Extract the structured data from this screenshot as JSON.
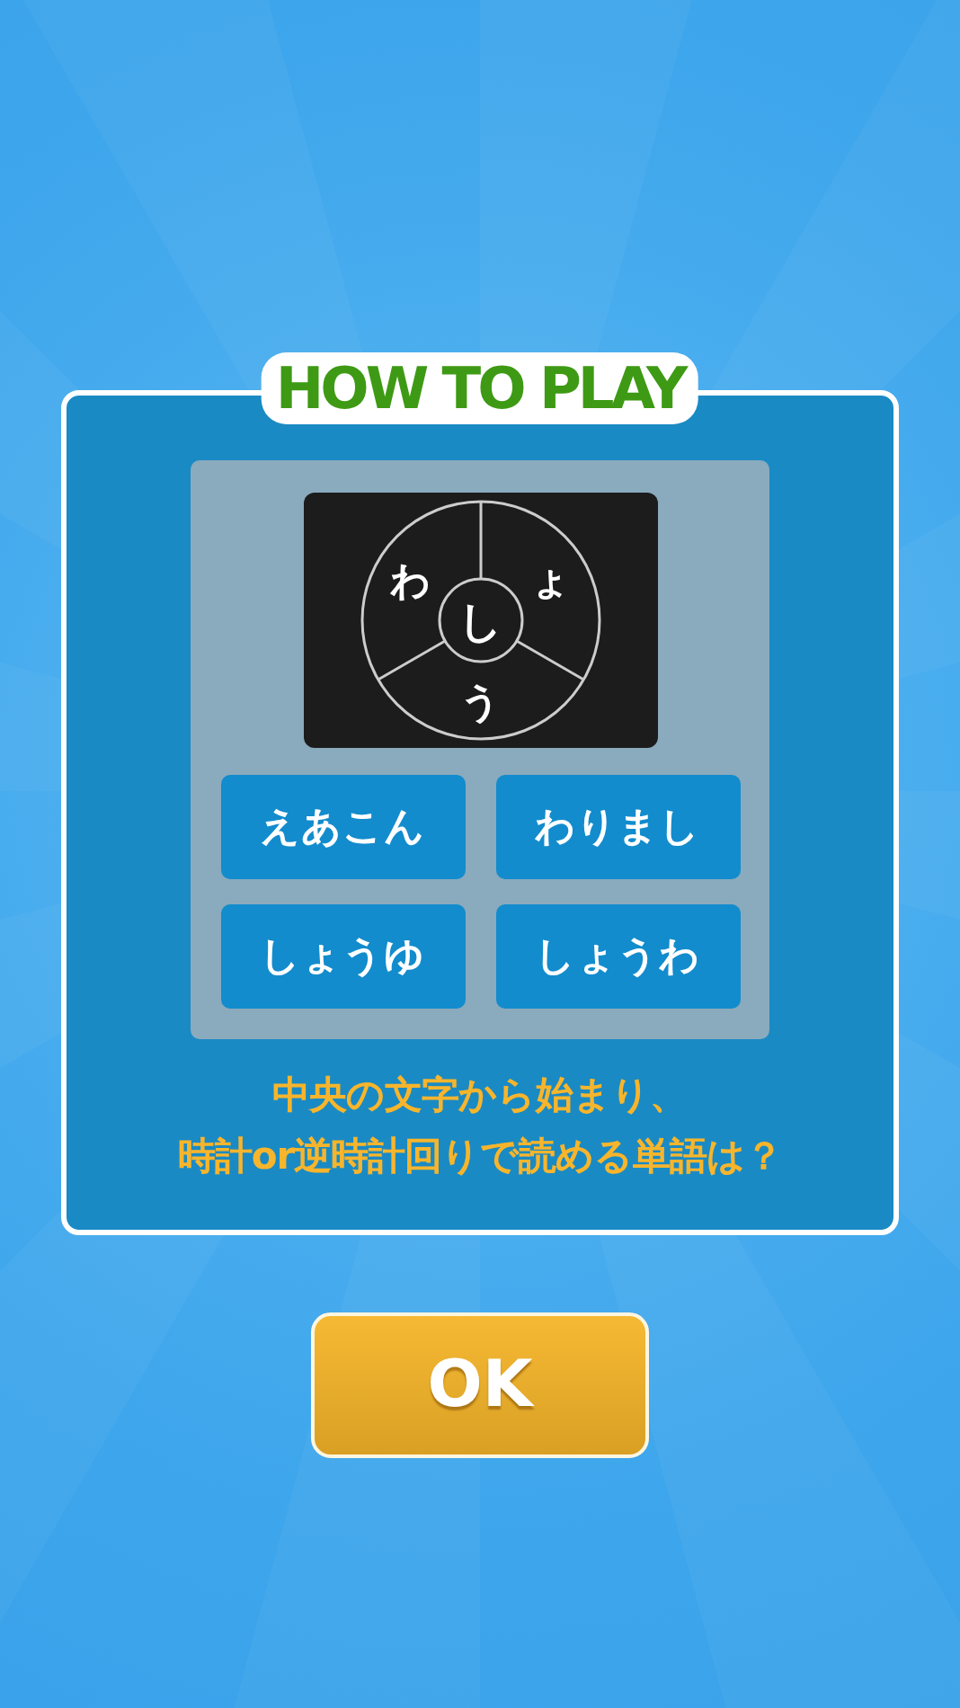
{
  "dialog": {
    "title": "HOW TO PLAY",
    "wheel": {
      "center": "し",
      "segments": [
        "ょ",
        "う",
        "わ"
      ]
    },
    "choices": [
      "えあこん",
      "わりまし",
      "しょうゆ",
      "しょうわ"
    ],
    "instruction": [
      "中央の文字から始まり、",
      "時計or逆時計回りで読める単語は？"
    ]
  },
  "ok_button": "OK"
}
